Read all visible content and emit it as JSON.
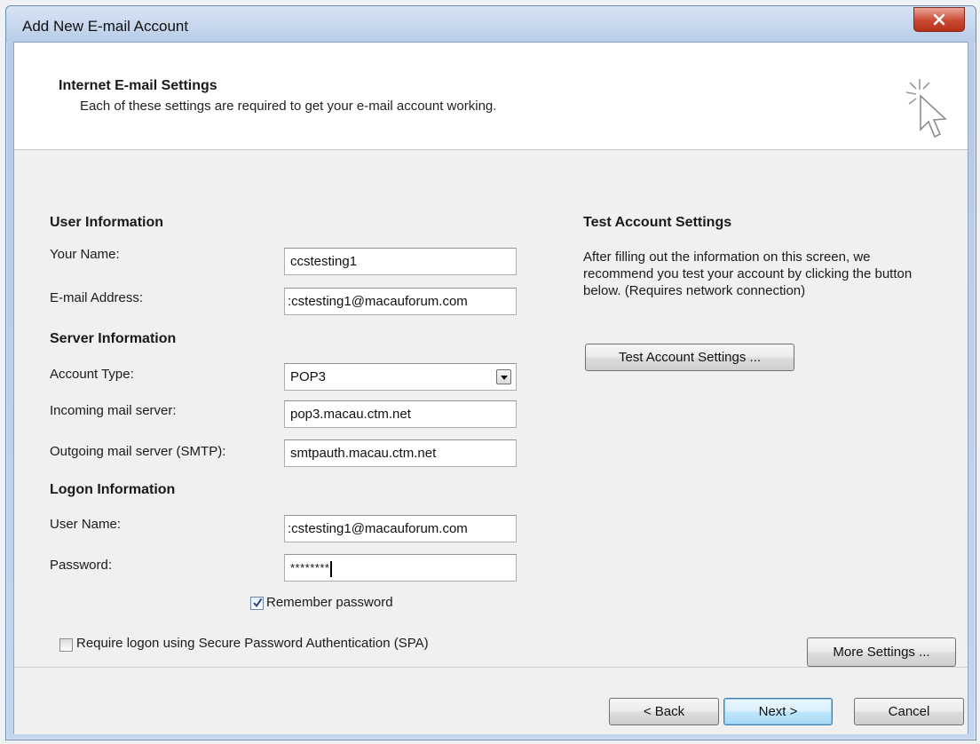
{
  "window": {
    "title": "Add New E-mail Account"
  },
  "header": {
    "title": "Internet E-mail Settings",
    "subtitle": "Each of these settings are required to get your e-mail account working."
  },
  "user_info": {
    "heading": "User Information",
    "name_label": "Your Name:",
    "name_value": "ccstesting1",
    "email_label": "E-mail Address:",
    "email_value": ":cstesting1@macauforum.com"
  },
  "server_info": {
    "heading": "Server Information",
    "account_type_label": "Account Type:",
    "account_type_value": "POP3",
    "incoming_label": "Incoming mail server:",
    "incoming_value": "pop3.macau.ctm.net",
    "outgoing_label": "Outgoing mail server (SMTP):",
    "outgoing_value": "smtpauth.macau.ctm.net"
  },
  "logon_info": {
    "heading": "Logon Information",
    "username_label": "User Name:",
    "username_value": ":cstesting1@macauforum.com",
    "password_label": "Password:",
    "password_value": "********",
    "remember_label": "Remember password",
    "remember_checked": true,
    "spa_label": "Require logon using Secure Password Authentication (SPA)",
    "spa_checked": false
  },
  "test_settings": {
    "heading": "Test Account Settings",
    "description": "After filling out the information on this screen, we recommend you test your account by clicking the button below. (Requires network connection)",
    "test_button": "Test Account Settings ...",
    "more_settings_button": "More Settings ..."
  },
  "footer": {
    "back_button": "< Back",
    "next_button": "Next >",
    "cancel_button": "Cancel"
  },
  "colors": {
    "close_button": "#c94a33",
    "default_button_border": "#3c7fb1",
    "panel_background": "#f0f0f0"
  }
}
